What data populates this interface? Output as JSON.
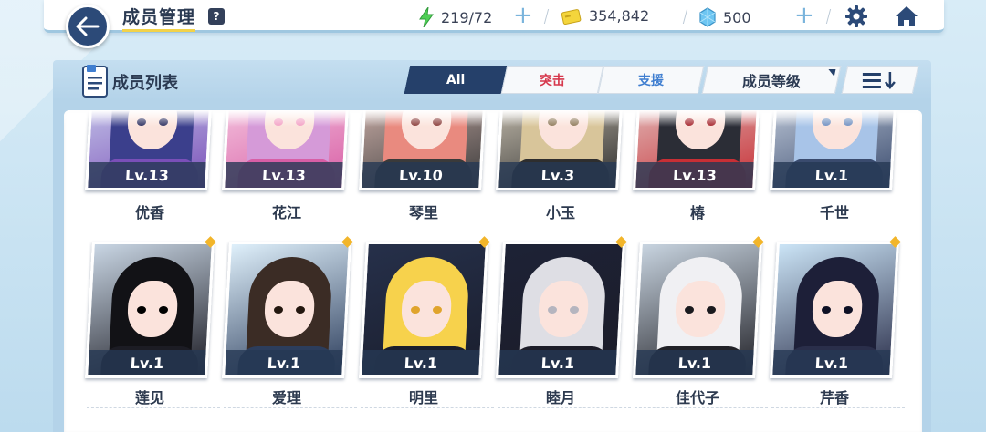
{
  "header": {
    "title": "成员管理",
    "help_label": "?"
  },
  "resources": {
    "ap": "219/72",
    "credits": "354,842",
    "pyroxene": "500"
  },
  "panel": {
    "title": "成员列表",
    "tabs": [
      {
        "label": "All",
        "active": true
      },
      {
        "label": "突击",
        "color": "#d6384c"
      },
      {
        "label": "支援",
        "color": "#3f7ed0"
      }
    ],
    "sort_label": "成员等级"
  },
  "members_row1": [
    {
      "name": "优香",
      "level": "Lv.13"
    },
    {
      "name": "花江",
      "level": "Lv.13"
    },
    {
      "name": "琴里",
      "level": "Lv.10"
    },
    {
      "name": "小玉",
      "level": "Lv.3"
    },
    {
      "name": "椿",
      "level": "Lv.13"
    },
    {
      "name": "千世",
      "level": "Lv.1"
    }
  ],
  "members_row2": [
    {
      "name": "莲见",
      "level": "Lv.1"
    },
    {
      "name": "爱理",
      "level": "Lv.1"
    },
    {
      "name": "明里",
      "level": "Lv.1"
    },
    {
      "name": "睦月",
      "level": "Lv.1"
    },
    {
      "name": "佳代子",
      "level": "Lv.1"
    },
    {
      "name": "芹香",
      "level": "Lv.1"
    }
  ],
  "colors": {
    "accent_dark": "#25406a",
    "new_marker": "#f2b52a"
  }
}
